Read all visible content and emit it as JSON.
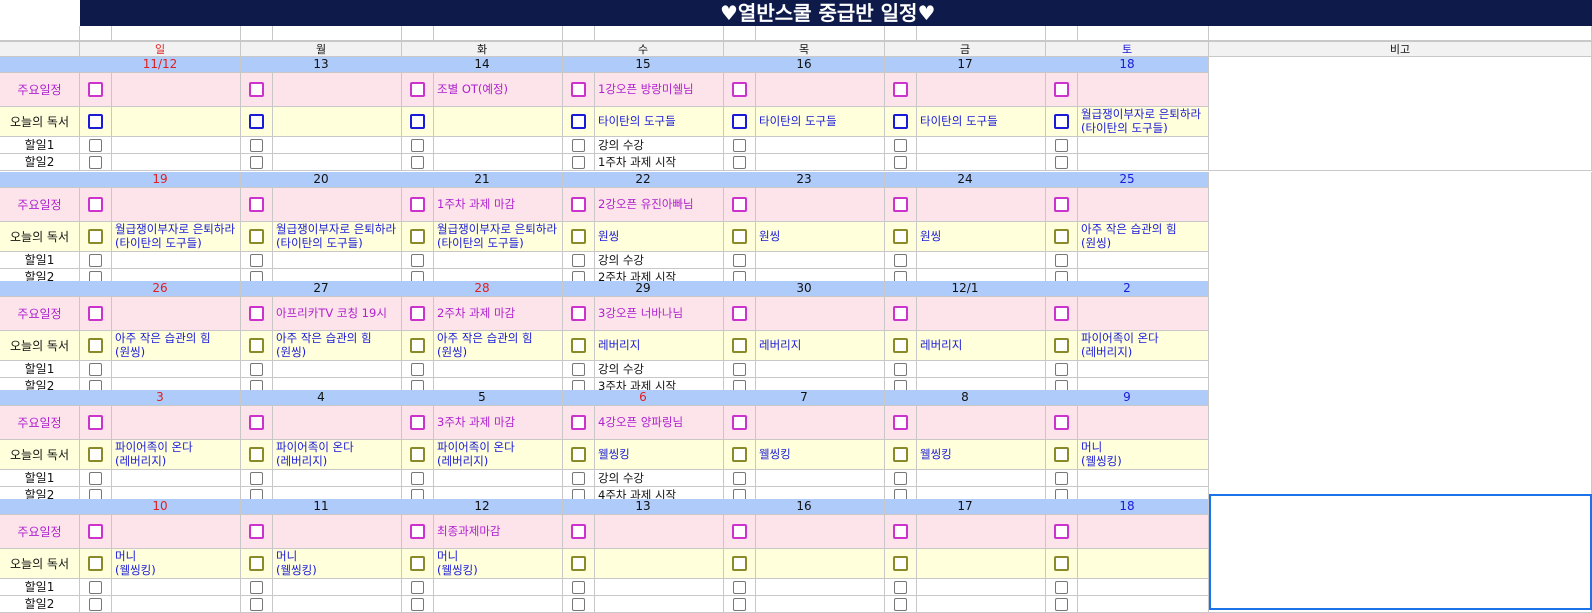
{
  "title": "♥열반스쿨 중급반 일정♥",
  "colors": {
    "title_bg": "#0d1a4a",
    "date_row_bg": "#aecbfa",
    "schedule_row_bg": "#fde4ea",
    "reading_row_bg": "#ffffdc",
    "sunday_red": "#e02020",
    "saturday_blue": "#1a1ad9",
    "schedule_magenta": "#b020d0"
  },
  "header": {
    "days": [
      "일",
      "월",
      "화",
      "수",
      "목",
      "금",
      "토"
    ],
    "notes_label": "비고"
  },
  "row_labels": {
    "schedule": "주요일정",
    "reading": "오늘의 독서",
    "todo1": "할일1",
    "todo2": "할일2"
  },
  "weeks": [
    {
      "dates": [
        {
          "t": "11/12",
          "c": "red"
        },
        {
          "t": "13",
          "c": "blk"
        },
        {
          "t": "14",
          "c": "blk"
        },
        {
          "t": "15",
          "c": "blk"
        },
        {
          "t": "16",
          "c": "blk"
        },
        {
          "t": "17",
          "c": "blk"
        },
        {
          "t": "18",
          "c": "blu"
        }
      ],
      "schedule": [
        "",
        "",
        "조별 OT(예정)",
        "1강오픈 방랑미쉘님",
        "",
        "",
        ""
      ],
      "reading": [
        "",
        "",
        "",
        "타이탄의 도구들",
        "타이탄의 도구들",
        "타이탄의 도구들",
        "월급쟁이부자로 은퇴하라\n(타이탄의 도구들)"
      ],
      "reading_box": "b",
      "todo1": [
        "",
        "",
        "",
        "강의 수강",
        "",
        "",
        ""
      ],
      "todo2": [
        "",
        "",
        "",
        "1주차 과제 시작",
        "",
        "",
        ""
      ]
    },
    {
      "dates": [
        {
          "t": "19",
          "c": "red"
        },
        {
          "t": "20",
          "c": "blk"
        },
        {
          "t": "21",
          "c": "blk"
        },
        {
          "t": "22",
          "c": "blk"
        },
        {
          "t": "23",
          "c": "blk"
        },
        {
          "t": "24",
          "c": "blk"
        },
        {
          "t": "25",
          "c": "blu"
        }
      ],
      "schedule": [
        "",
        "",
        "1주차 과제 마감",
        "2강오픈 유진아빠님",
        "",
        "",
        ""
      ],
      "reading": [
        "월급쟁이부자로 은퇴하라\n(타이탄의 도구들)",
        "월급쟁이부자로 은퇴하라\n(타이탄의 도구들)",
        "월급쟁이부자로 은퇴하라\n(타이탄의 도구들)",
        "원씽",
        "원씽",
        "원씽",
        "아주 작은 습관의 힘\n(원씽)"
      ],
      "reading_box": "o",
      "todo1": [
        "",
        "",
        "",
        "강의 수강",
        "",
        "",
        ""
      ],
      "todo2": [
        "",
        "",
        "",
        "2주차 과제 시작",
        "",
        "",
        ""
      ]
    },
    {
      "dates": [
        {
          "t": "26",
          "c": "red"
        },
        {
          "t": "27",
          "c": "blk"
        },
        {
          "t": "28",
          "c": "red"
        },
        {
          "t": "29",
          "c": "blk"
        },
        {
          "t": "30",
          "c": "blk"
        },
        {
          "t": "12/1",
          "c": "blk"
        },
        {
          "t": "2",
          "c": "blu"
        }
      ],
      "schedule": [
        "",
        "아프리카TV 코칭 19시",
        "2주차 과제 마감",
        "3강오픈 너바나님",
        "",
        "",
        ""
      ],
      "reading": [
        "아주 작은 습관의 힘\n(원씽)",
        "아주 작은 습관의 힘\n(원씽)",
        "아주 작은 습관의 힘\n(원씽)",
        "레버리지",
        "레버리지",
        "레버리지",
        "파이어족이 온다\n(레버리지)"
      ],
      "reading_box": "o",
      "todo1": [
        "",
        "",
        "",
        "강의 수강",
        "",
        "",
        ""
      ],
      "todo2": [
        "",
        "",
        "",
        "3주차 과제 시작",
        "",
        "",
        ""
      ]
    },
    {
      "dates": [
        {
          "t": "3",
          "c": "red"
        },
        {
          "t": "4",
          "c": "blk"
        },
        {
          "t": "5",
          "c": "blk"
        },
        {
          "t": "6",
          "c": "red"
        },
        {
          "t": "7",
          "c": "blk"
        },
        {
          "t": "8",
          "c": "blk"
        },
        {
          "t": "9",
          "c": "blu"
        }
      ],
      "schedule": [
        "",
        "",
        "3주차 과제 마감",
        "4강오픈 양파링님",
        "",
        "",
        ""
      ],
      "reading": [
        "파이어족이 온다\n(레버리지)",
        "파이어족이 온다\n(레버리지)",
        "파이어족이 온다\n(레버리지)",
        "웰씽킹",
        "웰씽킹",
        "웰씽킹",
        "머니\n(웰씽킹)"
      ],
      "reading_box": "o",
      "todo1": [
        "",
        "",
        "",
        "강의 수강",
        "",
        "",
        ""
      ],
      "todo2": [
        "",
        "",
        "",
        "4주차 과제 시작",
        "",
        "",
        ""
      ]
    },
    {
      "dates": [
        {
          "t": "10",
          "c": "red"
        },
        {
          "t": "11",
          "c": "blk"
        },
        {
          "t": "12",
          "c": "blk"
        },
        {
          "t": "13",
          "c": "blk"
        },
        {
          "t": "16",
          "c": "blk"
        },
        {
          "t": "17",
          "c": "blk"
        },
        {
          "t": "18",
          "c": "blu"
        }
      ],
      "schedule": [
        "",
        "",
        "최종과제마감",
        "",
        "",
        "",
        ""
      ],
      "reading": [
        "머니\n(웰씽킹)",
        "머니\n(웰씽킹)",
        "머니\n(웰씽킹)",
        "",
        "",
        "",
        ""
      ],
      "reading_box": "o",
      "todo1": [
        "",
        "",
        "",
        "",
        "",
        "",
        ""
      ],
      "todo2": [
        "",
        "",
        "",
        "",
        "",
        "",
        ""
      ]
    }
  ]
}
